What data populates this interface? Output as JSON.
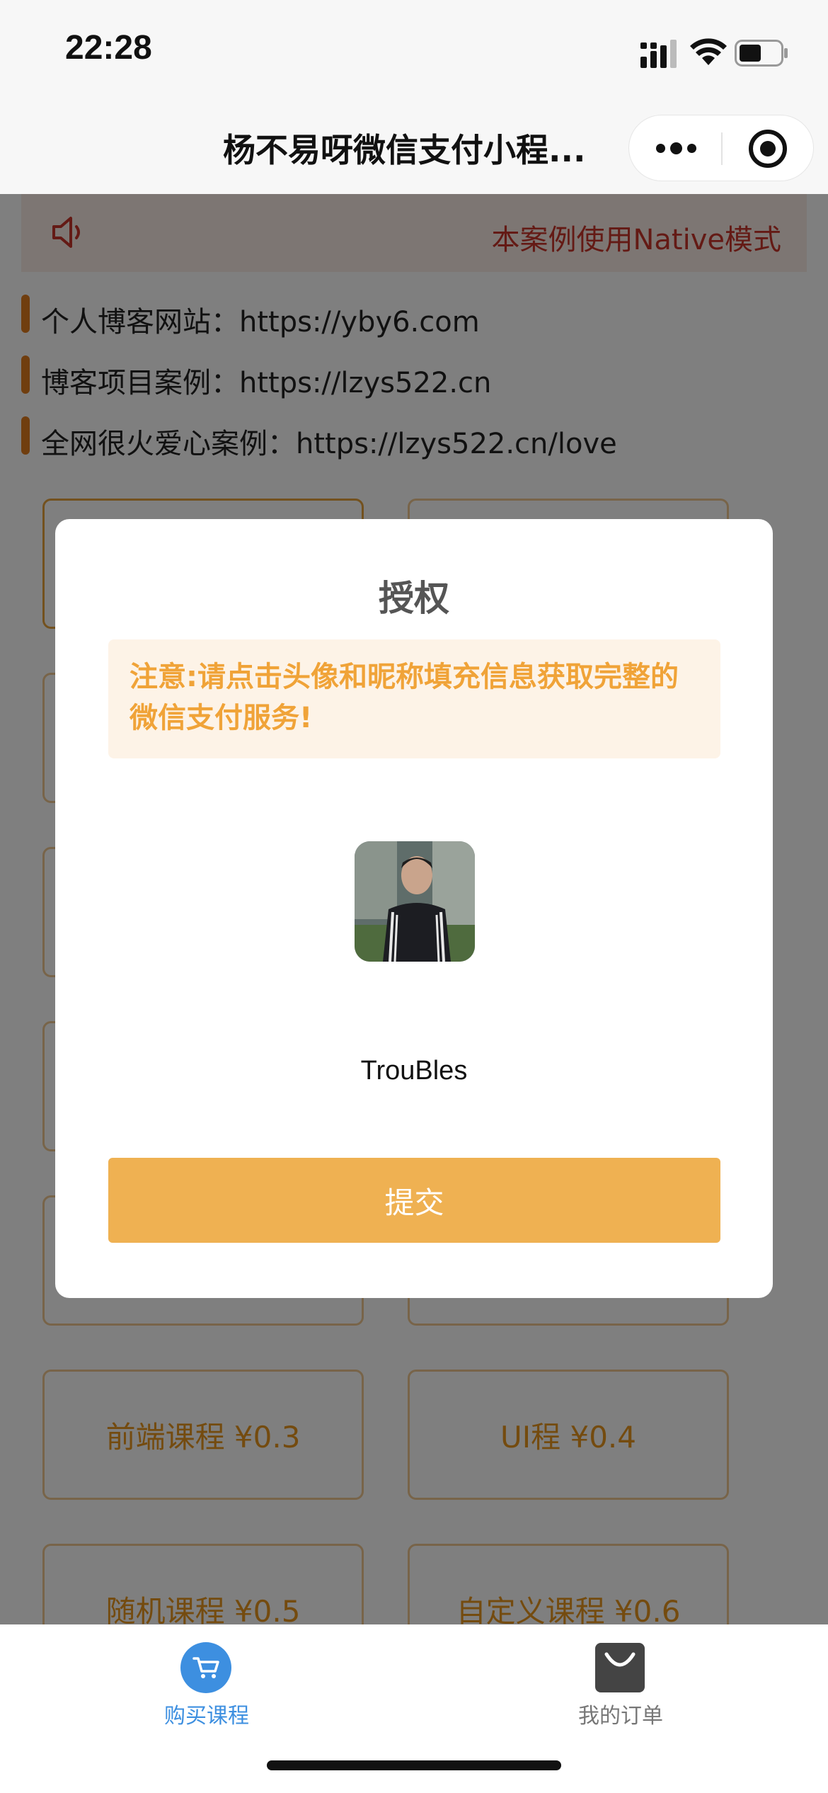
{
  "status_bar": {
    "time": "22:28"
  },
  "nav": {
    "title": "杨不易呀微信支付小程..."
  },
  "notice": {
    "text": "本案例使用Native模式"
  },
  "links": [
    {
      "text": "个人博客网站：https://yby6.com"
    },
    {
      "text": "博客项目案例：https://lzys522.cn"
    },
    {
      "text": "全网很火爱心案例：https://lzys522.cn/love"
    }
  ],
  "courses": [
    {
      "label": "前端课程 ¥0.3"
    },
    {
      "label": "UI程 ¥0.4"
    },
    {
      "label": "随机课程 ¥0.5"
    },
    {
      "label": "自定义课程 ¥0.6"
    }
  ],
  "modal": {
    "title": "授权",
    "warning": "注意:请点击头像和昵称填充信息获取完整的微信支付服务!",
    "nickname": "TrouBles",
    "submit_label": "提交"
  },
  "tabs": [
    {
      "label": "购买课程",
      "icon": "cart-icon",
      "color": "#3d8fe0"
    },
    {
      "label": "我的订单",
      "icon": "bag-icon",
      "color": "#777777"
    }
  ],
  "colors": {
    "accent_orange": "#efb152",
    "notice_red": "#c8352a",
    "card_text": "#e8961e",
    "tab_active": "#3d8fe0"
  }
}
